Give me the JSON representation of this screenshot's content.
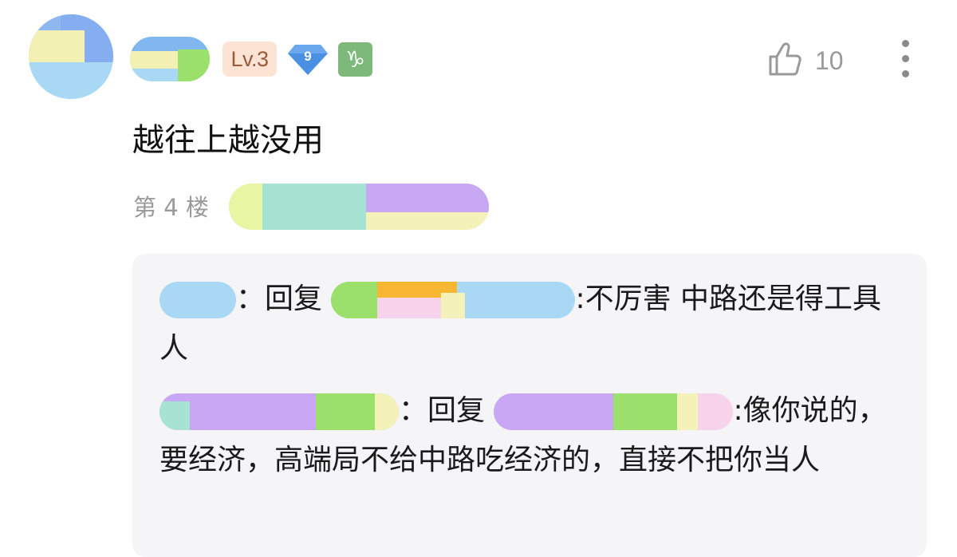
{
  "header": {
    "level_badge": "Lv.3",
    "diamond_badge": "9",
    "zodiac_badge": "♑",
    "like_count": "10"
  },
  "comment": {
    "text": "越往上越没用",
    "floor_label": "第 4 楼"
  },
  "replies": [
    {
      "separator": "：",
      "reply_word": "回复 ",
      "text": ":不厉害 中路还是得工具人"
    },
    {
      "separator": "：",
      "reply_word": "回复 ",
      "text": ":像你说的，要经济，高端局不给中路吃经济的，直接不把你当人"
    }
  ],
  "icons": {
    "like": "thumbs-up-icon",
    "more": "more-vertical-icon",
    "diamond": "diamond-icon",
    "zodiac": "capricorn-icon"
  },
  "colors": {
    "level_badge_bg": "#fde3d3",
    "level_badge_text": "#9a5a3c",
    "diamond": "#4a90e2",
    "zodiac_badge_bg": "#7cb97a",
    "meta_text": "#9a9a9a",
    "reply_box_bg": "#f5f5f7"
  }
}
